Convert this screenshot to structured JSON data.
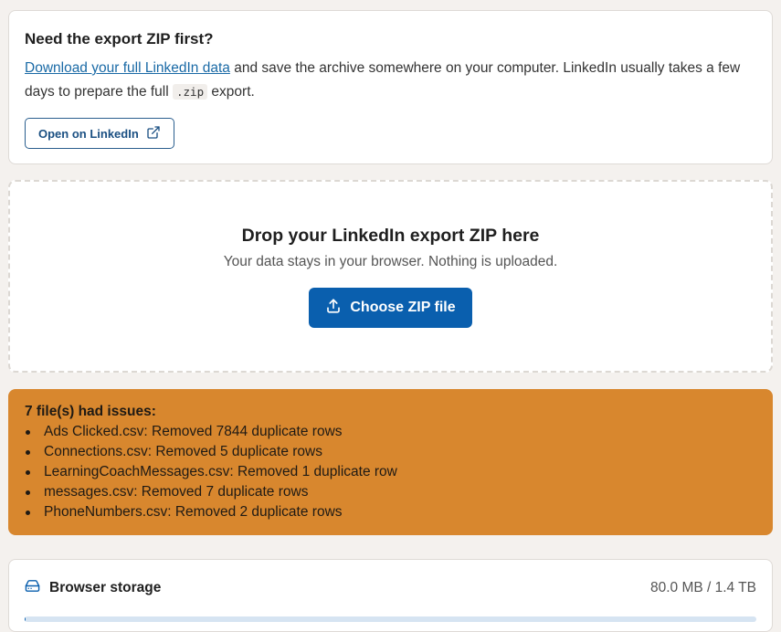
{
  "export_card": {
    "title": "Need the export ZIP first?",
    "link_text": "Download your full LinkedIn data",
    "desc_part1": " and save the archive somewhere on your computer. LinkedIn usually takes a few days to prepare the full ",
    "code": ".zip",
    "desc_part2": " export.",
    "button_label": "Open on LinkedIn",
    "button_icon": "external-link-icon"
  },
  "drop_zone": {
    "title": "Drop your LinkedIn export ZIP here",
    "subtitle": "Your data stays in your browser. Nothing is uploaded.",
    "button_label": "Choose ZIP file",
    "button_icon": "upload-icon"
  },
  "issues": {
    "title": "7 file(s) had issues:",
    "items": [
      "Ads Clicked.csv: Removed 7844 duplicate rows",
      "Connections.csv: Removed 5 duplicate rows",
      "LearningCoachMessages.csv: Removed 1 duplicate row",
      "messages.csv: Removed 7 duplicate rows",
      "PhoneNumbers.csv: Removed 2 duplicate rows"
    ],
    "color": "#d8872e"
  },
  "storage": {
    "label": "Browser storage",
    "icon": "hard-drive-icon",
    "usage": "80.0 MB / 1.4 TB",
    "used_fraction": 0.0001
  },
  "colors": {
    "primary": "#0a5fae",
    "link": "#1a6aa6",
    "warning": "#d8872e",
    "background": "#f4f1ee"
  }
}
